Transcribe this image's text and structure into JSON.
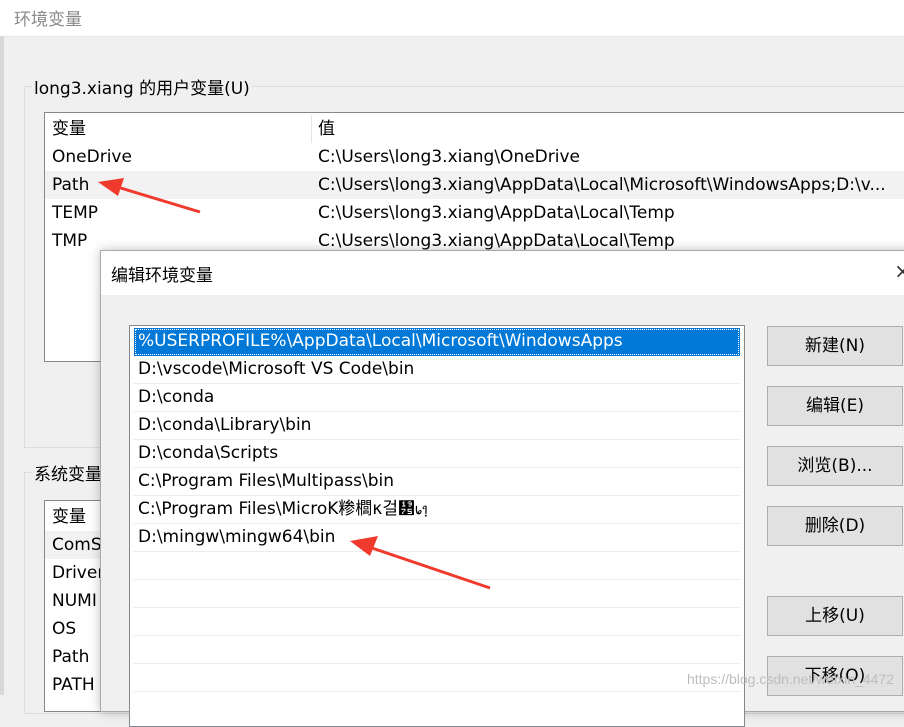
{
  "window": {
    "title": "环境变量"
  },
  "user_vars": {
    "group_label": "long3.xiang 的用户变量(U)",
    "columns": [
      "变量",
      "值"
    ],
    "rows": [
      {
        "name": "OneDrive",
        "value": "C:\\Users\\long3.xiang\\OneDrive"
      },
      {
        "name": "Path",
        "value": "C:\\Users\\long3.xiang\\AppData\\Local\\Microsoft\\WindowsApps;D:\\v..."
      },
      {
        "name": "TEMP",
        "value": "C:\\Users\\long3.xiang\\AppData\\Local\\Temp"
      },
      {
        "name": "TMP",
        "value": "C:\\Users\\long3.xiang\\AppData\\Local\\Temp"
      }
    ]
  },
  "system_vars": {
    "group_label": "系统变量",
    "column": "变量",
    "rows": [
      "ComS",
      "Driver",
      "NUMI",
      "OS",
      "Path",
      "PATH"
    ]
  },
  "edit_dialog": {
    "title": "编辑环境变量",
    "close_icon": "×",
    "entries": [
      "%USERPROFILE%\\AppData\\Local\\Microsoft\\WindowsApps",
      "D:\\vscode\\Microsoft VS Code\\bin",
      "D:\\conda",
      "D:\\conda\\Library\\bin",
      "D:\\conda\\Scripts",
      "C:\\Program Files\\Multipass\\bin",
      "C:\\Program Files\\MicroK糁櫚κ걸᥵᥇᥄",
      "D:\\mingw\\mingw64\\bin"
    ],
    "buttons": {
      "new": "新建(N)",
      "edit": "编辑(E)",
      "browse": "浏览(B)...",
      "delete": "删除(D)",
      "move_up": "上移(U)",
      "move_down": "下移(O)"
    }
  },
  "watermark": "https://blog.csdn.net/weixin_4472",
  "colors": {
    "selection": "#0078d7",
    "arrow": "#f03a2e"
  }
}
